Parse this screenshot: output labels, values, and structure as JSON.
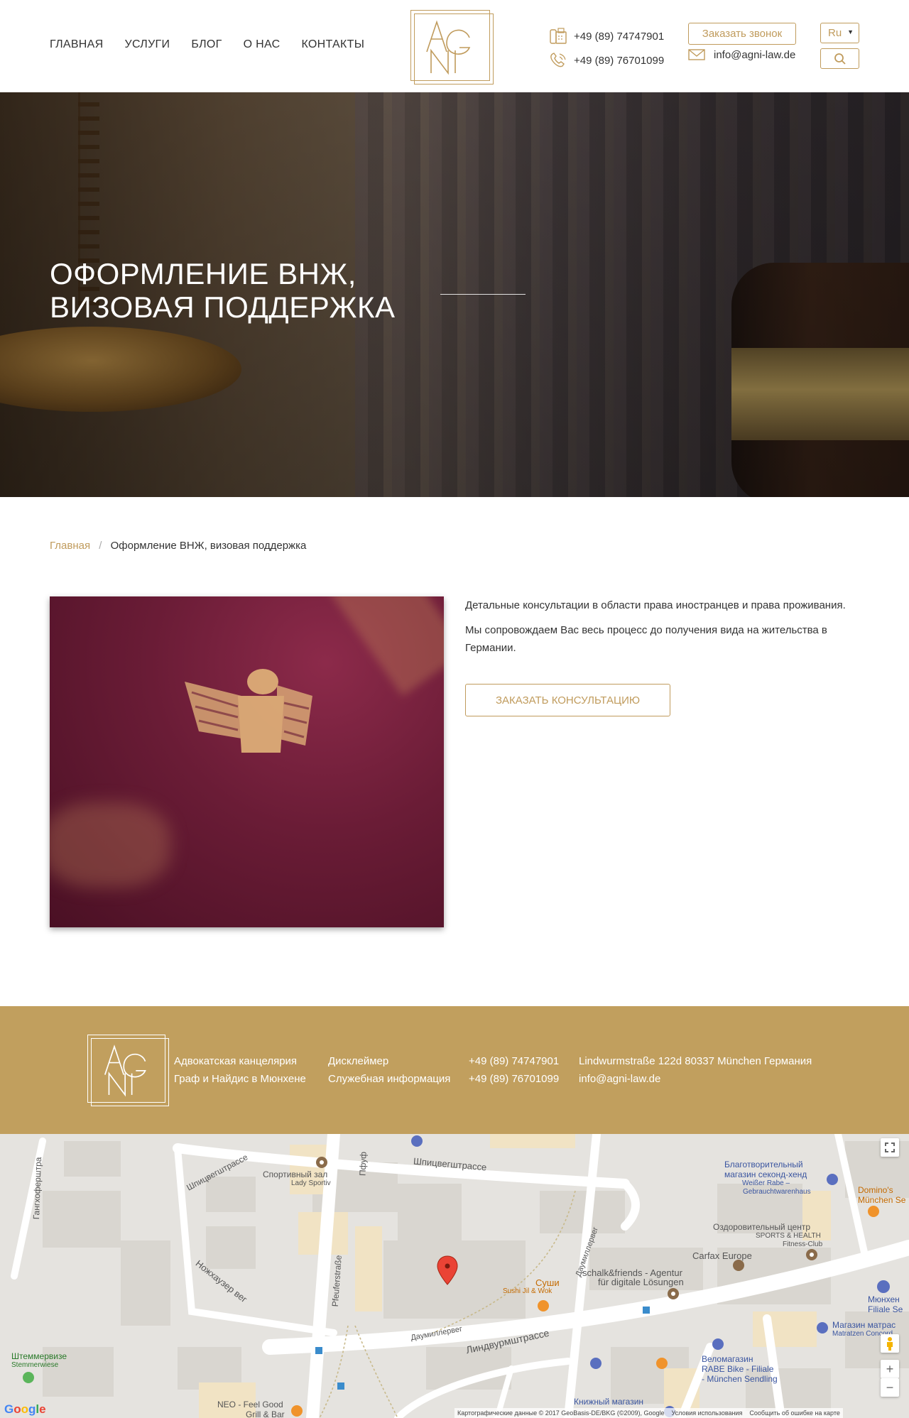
{
  "nav": {
    "items": [
      {
        "label": "ГЛАВНАЯ"
      },
      {
        "label": "УСЛУГИ"
      },
      {
        "label": "БЛОГ"
      },
      {
        "label": "О НАС"
      },
      {
        "label": "КОНТАКТЫ"
      }
    ]
  },
  "header": {
    "phone1": "+49 (89) 74747901",
    "phone2": "+49 (89) 76701099",
    "callback_label": "Заказать звонок",
    "email": "info@agni-law.de",
    "language": "Ru"
  },
  "hero": {
    "title_line1": "ОФОРМЛЕНИЕ ВНЖ,",
    "title_line2": "ВИЗОВАЯ ПОДДЕРЖКА"
  },
  "breadcrumb": {
    "home": "Главная",
    "separator": "/",
    "current": "Оформление ВНЖ, визовая поддержка"
  },
  "content": {
    "paragraph1": "Детальные консультации в области права иностранцев и права проживания.",
    "paragraph2": "Мы сопровождаем Вас весь процесс до получения вида на жительства в Германии.",
    "consult_label": "ЗАКАЗАТЬ КОНСУЛЬТАЦИЮ"
  },
  "footer": {
    "firm_line1": "Адвокатская канцелярия",
    "firm_line2": "Граф и Найдис в Мюнхене",
    "disclaimer": "Дисклеймер",
    "service_info": "Служебная информация",
    "phone1": "+49 (89) 74747901",
    "phone2": "+49 (89) 76701099",
    "address": "Lindwurmstraße 122d 80337 München Германия",
    "email": "info@agni-law.de"
  },
  "map": {
    "labels": {
      "ganghofer": "Гангхоферштра",
      "spitzweg1": "Шпицвегштрассе",
      "spitzweg2": "Шпицвегштрассе",
      "pfeufer_ru": "Пфуф",
      "pfeufer_de": "Pfeuferstraße",
      "sport1": "Спортивный зал",
      "sport2": "Lady Sportiv",
      "charity1": "Благотворительный",
      "charity2": "магазин секонд-хенд",
      "charity3": "Weißer Rabe –",
      "charity4": "Gebrauchtwarenhaus",
      "dominos1": "Domino's",
      "dominos2": "München Se",
      "health1": "Оздоровительный центр",
      "health2": "SPORTS & HEALTH",
      "health3": "Fitness-Club",
      "carfax": "Carfax Europe",
      "daumiller1": "Даумиллервег",
      "daumiller2": "Даумиллервег",
      "schalk1": "schalk&friends - Agentur",
      "schalk2": "für digitale Lösungen",
      "sushi1": "Суши",
      "sushi2": "Sushi Jil & Wok",
      "nojhauzer": "Ножхаузер вег",
      "lindwurm": "Линдвурмштрассе",
      "matras1": "Магазин матрас",
      "matras2": "Matratzen Concord",
      "munich1": "Мюнхен",
      "munich2": "Filiale Se",
      "stemmer1": "Штеммервизе",
      "stemmer2": "Stemmerwiese",
      "velo1": "Веломагазин",
      "velo2": "RABE Bike - Filiale",
      "velo3": "- München Sendling",
      "neo1": "NEO - Feel Good",
      "neo2": "Grill & Bar",
      "book": "Книжный магазин",
      "google": "Google",
      "copyright": "Картографические данные © 2017 GeoBasis-DE/BKG (©2009), Google",
      "terms": "Условия использования",
      "report": "Сообщить об ошибке на карте"
    }
  },
  "colors": {
    "accent": "#c09b5c",
    "footer_bg": "#c19f5e"
  }
}
